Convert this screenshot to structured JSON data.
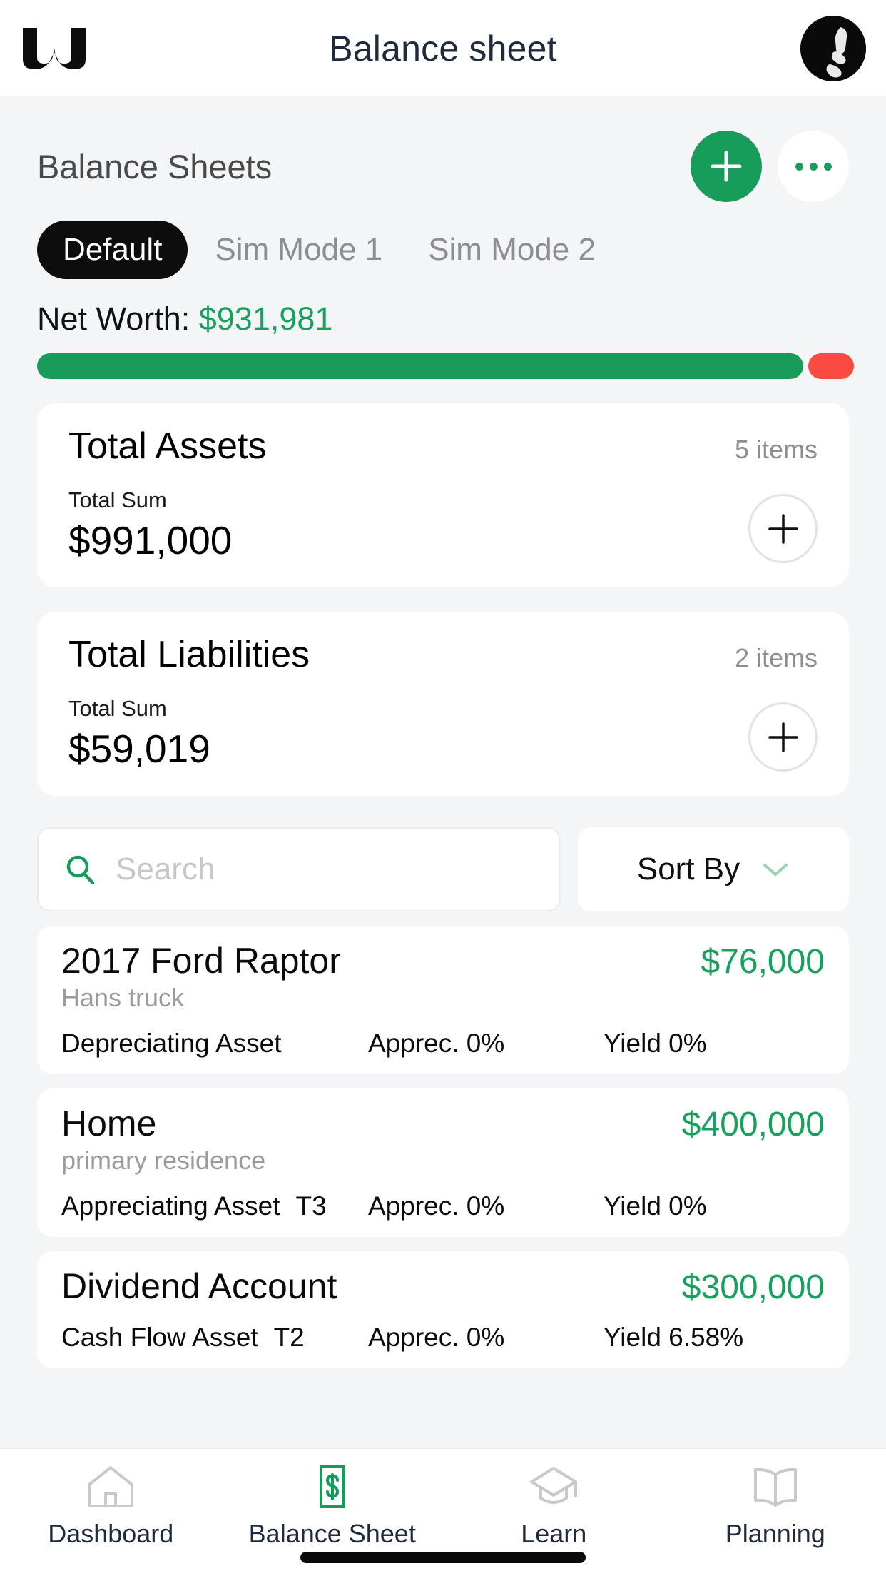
{
  "header": {
    "logo_icon": "w-logo-icon",
    "title": "Balance sheet",
    "avatar_icon": "user-avatar"
  },
  "section": {
    "title": "Balance Sheets",
    "add_icon": "plus-icon",
    "more_icon": "ellipsis-icon"
  },
  "tabs": [
    {
      "label": "Default",
      "active": true
    },
    {
      "label": "Sim Mode 1",
      "active": false
    },
    {
      "label": "Sim Mode 2",
      "active": false
    }
  ],
  "net_worth": {
    "label": "Net Worth:",
    "value": "$931,981",
    "green_pct": 94.4,
    "red_pct": 5.6,
    "green_color": "#189b59",
    "red_color": "#fa4a41"
  },
  "summary_cards": [
    {
      "title": "Total Assets",
      "count": "5 items",
      "sum_label": "Total Sum",
      "sum_value": "$991,000",
      "add_icon": "plus-icon"
    },
    {
      "title": "Total Liabilities",
      "count": "2 items",
      "sum_label": "Total Sum",
      "sum_value": "$59,019",
      "add_icon": "plus-icon"
    }
  ],
  "filters": {
    "search_icon": "search-icon",
    "search_value": "",
    "search_placeholder": "Search",
    "sort_label": "Sort By",
    "sort_chevron_icon": "chevron-down-icon"
  },
  "items": [
    {
      "name": "2017 Ford Raptor",
      "subtitle": "Hans truck",
      "value": "$76,000",
      "type": "Depreciating Asset",
      "tier": "",
      "apprec": "Apprec. 0%",
      "yield": "Yield 0%"
    },
    {
      "name": "Home",
      "subtitle": "primary residence",
      "value": "$400,000",
      "type": "Appreciating Asset",
      "tier": "T3",
      "apprec": "Apprec. 0%",
      "yield": "Yield 0%"
    },
    {
      "name": "Dividend Account",
      "subtitle": "",
      "value": "$300,000",
      "type": "Cash Flow Asset",
      "tier": "T2",
      "apprec": "Apprec. 0%",
      "yield": "Yield 6.58%"
    }
  ],
  "bottom_nav": [
    {
      "label": "Dashboard",
      "icon": "home-icon",
      "active": false
    },
    {
      "label": "Balance Sheet",
      "icon": "dollar-bill-icon",
      "active": true
    },
    {
      "label": "Learn",
      "icon": "graduation-cap-icon",
      "active": false
    },
    {
      "label": "Planning",
      "icon": "open-book-icon",
      "active": false
    }
  ],
  "colors": {
    "accent_green": "#179c5a",
    "alert_red": "#fa4a41",
    "nav_label": "#1f2a3d"
  }
}
